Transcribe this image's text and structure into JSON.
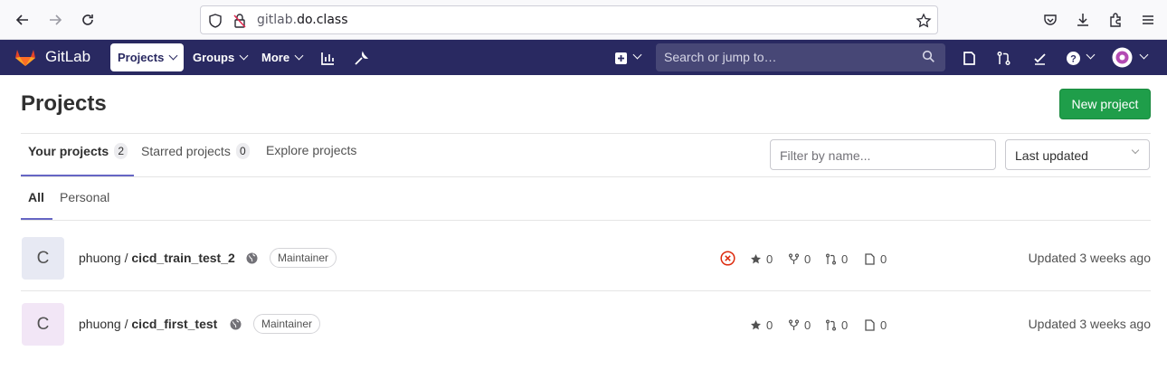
{
  "browser": {
    "url_prefix": "gitlab.",
    "url_domain": "do.class",
    "icons": [
      "back-icon",
      "forward-icon",
      "reload-icon",
      "shield-icon",
      "lock-icon",
      "star-icon",
      "pocket-icon",
      "download-icon",
      "extensions-icon",
      "menu-icon"
    ]
  },
  "nav": {
    "brand": "GitLab",
    "items": [
      {
        "label": "Projects",
        "active": true
      },
      {
        "label": "Groups",
        "active": false
      },
      {
        "label": "More",
        "active": false
      }
    ],
    "search_placeholder": "Search or jump to…",
    "colors": {
      "bar": "#292961",
      "search": "#474776"
    }
  },
  "page": {
    "title": "Projects",
    "new_project_label": "New project",
    "tabs": [
      {
        "label": "Your projects",
        "count": "2",
        "active": true
      },
      {
        "label": "Starred projects",
        "count": "0",
        "active": false
      },
      {
        "label": "Explore projects",
        "count": null,
        "active": false
      }
    ],
    "filter_placeholder": "Filter by name...",
    "sort_value": "Last updated",
    "subtabs": [
      {
        "label": "All",
        "active": true
      },
      {
        "label": "Personal",
        "active": false
      }
    ]
  },
  "projects": [
    {
      "avatar_letter": "C",
      "avatar_color": "#e7e9f3",
      "namespace": "phuong / ",
      "name": "cicd_train_test_2",
      "role": "Maintainer",
      "pipeline_status": "failed",
      "stars": "0",
      "forks": "0",
      "merge_requests": "0",
      "issues": "0",
      "updated": "Updated 3 weeks ago"
    },
    {
      "avatar_letter": "C",
      "avatar_color": "#f2e6f6",
      "namespace": "phuong / ",
      "name": "cicd_first_test",
      "role": "Maintainer",
      "pipeline_status": null,
      "stars": "0",
      "forks": "0",
      "merge_requests": "0",
      "issues": "0",
      "updated": "Updated 3 weeks ago"
    }
  ]
}
